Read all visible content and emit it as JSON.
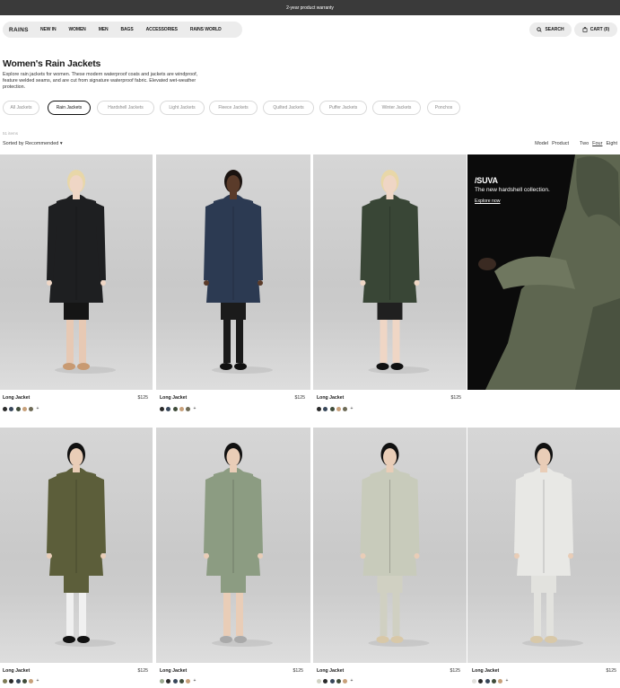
{
  "topbar": {
    "message": "2-year product warranty"
  },
  "header": {
    "logo": "RAINS",
    "nav": [
      "NEW IN",
      "WOMEN",
      "MEN",
      "BAGS",
      "ACCESSORIES",
      "RAINS WORLD"
    ],
    "search_label": "SEARCH",
    "cart_label": "CART (0)"
  },
  "page": {
    "title": "Women's Rain Jackets",
    "description": "Explore rain jackets for women. These modern waterproof coats and jackets are windproof, feature welded seams, and are cut from signature waterproof fabric. Elevated wet-weather protection.",
    "count": "51 items"
  },
  "filters": [
    "All Jackets",
    "Rain Jackets",
    "Hardshell Jackets",
    "Light Jackets",
    "Fleece Jackets",
    "Quilted Jackets",
    "Puffer Jackets",
    "Winter Jackets",
    "Ponchos"
  ],
  "active_filter": "Rain Jackets",
  "sort": {
    "label": "Sorted by Recommended ▾"
  },
  "view": {
    "modes": [
      "Model",
      "Product"
    ],
    "grid": [
      "Two",
      "Four",
      "Eight"
    ],
    "selected_grid": "Four"
  },
  "promo": {
    "title": "/SUVA",
    "subtitle": "The new hardshell collection.",
    "link": "Explore now"
  },
  "products": [
    {
      "name": "Long Jacket",
      "price": "$125",
      "coat": "#1e1f21",
      "bottom": "#151515",
      "legs": "#e7c9b4",
      "shoes": "#c89a72",
      "skin": "#efd6c5",
      "hair": "#e8d7a8",
      "swatches": [
        "#2a2a2a",
        "#38475a",
        "#3f4c3a",
        "#c7a07a",
        "#6d6a55"
      ]
    },
    {
      "name": "Long Jacket",
      "price": "$125",
      "coat": "#2c3a52",
      "bottom": "#1b1b1b",
      "legs": "#1a1a1a",
      "shoes": "#111111",
      "skin": "#5a3b2a",
      "hair": "#1a1310",
      "swatches": [
        "#2a2a2a",
        "#38475a",
        "#3f4c3a",
        "#c7a07a",
        "#6d6a55"
      ]
    },
    {
      "name": "Long Jacket",
      "price": "$125",
      "coat": "#394636",
      "bottom": "#202020",
      "legs": "#efd6c5",
      "shoes": "#111111",
      "skin": "#efd6c5",
      "hair": "#e8d7a8",
      "swatches": [
        "#2a2a2a",
        "#38475a",
        "#3f4c3a",
        "#c7a07a",
        "#6d6a55"
      ]
    },
    {
      "name": "Long Jacket",
      "price": "$125",
      "coat": "#5c5e3a",
      "bottom": "#5c5e3a",
      "legs": "#f0f0f0",
      "shoes": "#111111",
      "skin": "#e9cdb7",
      "hair": "#111111",
      "swatches": [
        "#7d7b56",
        "#2a2a2a",
        "#38475a",
        "#3f4c3a",
        "#c7a07a"
      ]
    },
    {
      "name": "Long Jacket",
      "price": "$125",
      "coat": "#8c9c82",
      "bottom": "#8c9c82",
      "legs": "#e9cdb7",
      "shoes": "#a9a9a9",
      "skin": "#e9cdb7",
      "hair": "#111111",
      "swatches": [
        "#9aa98f",
        "#2a2a2a",
        "#38475a",
        "#3f4c3a",
        "#c7a07a"
      ]
    },
    {
      "name": "Long Jacket",
      "price": "$125",
      "coat": "#c8cbbb",
      "bottom": "#d0d0c2",
      "legs": "#d0d0c2",
      "shoes": "#d8c8a8",
      "skin": "#e9cdb7",
      "hair": "#111111",
      "swatches": [
        "#d0d2c4",
        "#2a2a2a",
        "#38475a",
        "#3f4c3a",
        "#c7a07a"
      ]
    },
    {
      "name": "Long Jacket",
      "price": "$125",
      "coat": "#e8e8e5",
      "bottom": "#e2e2de",
      "legs": "#e2e2de",
      "shoes": "#d8c8a8",
      "skin": "#e9cdb7",
      "hair": "#111111",
      "swatches": [
        "#e0e0dc",
        "#2a2a2a",
        "#38475a",
        "#3f4c3a",
        "#c7a07a"
      ]
    }
  ]
}
